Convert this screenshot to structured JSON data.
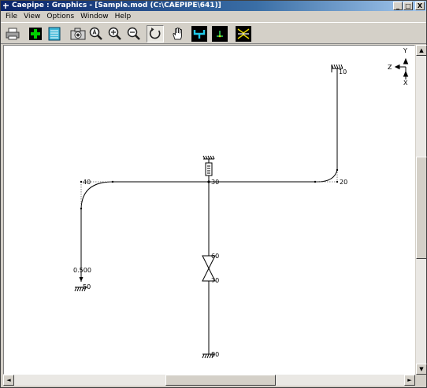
{
  "window": {
    "title": "Caepipe : Graphics - [Sample.mod (C:\\CAEPIPE\\641)]",
    "controls": {
      "minimize": "_",
      "restore": "□",
      "close": "X"
    }
  },
  "menu": {
    "items": [
      "File",
      "View",
      "Options",
      "Window",
      "Help"
    ]
  },
  "toolbar": {
    "buttons": [
      "print-icon",
      "add-icon",
      "list-icon",
      "camera-icon",
      "zoom-all-icon",
      "zoom-in-icon",
      "zoom-out-icon",
      "rotate-icon",
      "pan-hand-icon",
      "view-top-icon",
      "view-front-icon",
      "view-side-icon"
    ],
    "accent": "#00c000"
  },
  "axes": {
    "y": "Y",
    "z": "Z",
    "x": "X"
  },
  "model": {
    "nodes": {
      "n10": "10",
      "n20": "20",
      "n30": "30",
      "n40": "40",
      "n50": "50",
      "n60": "60",
      "n70": "70",
      "n80": "80"
    },
    "annotation": "0.500",
    "line_color": "#000000"
  },
  "scrollbars": {
    "up": "▲",
    "down": "▼",
    "left": "◄",
    "right": "►"
  }
}
